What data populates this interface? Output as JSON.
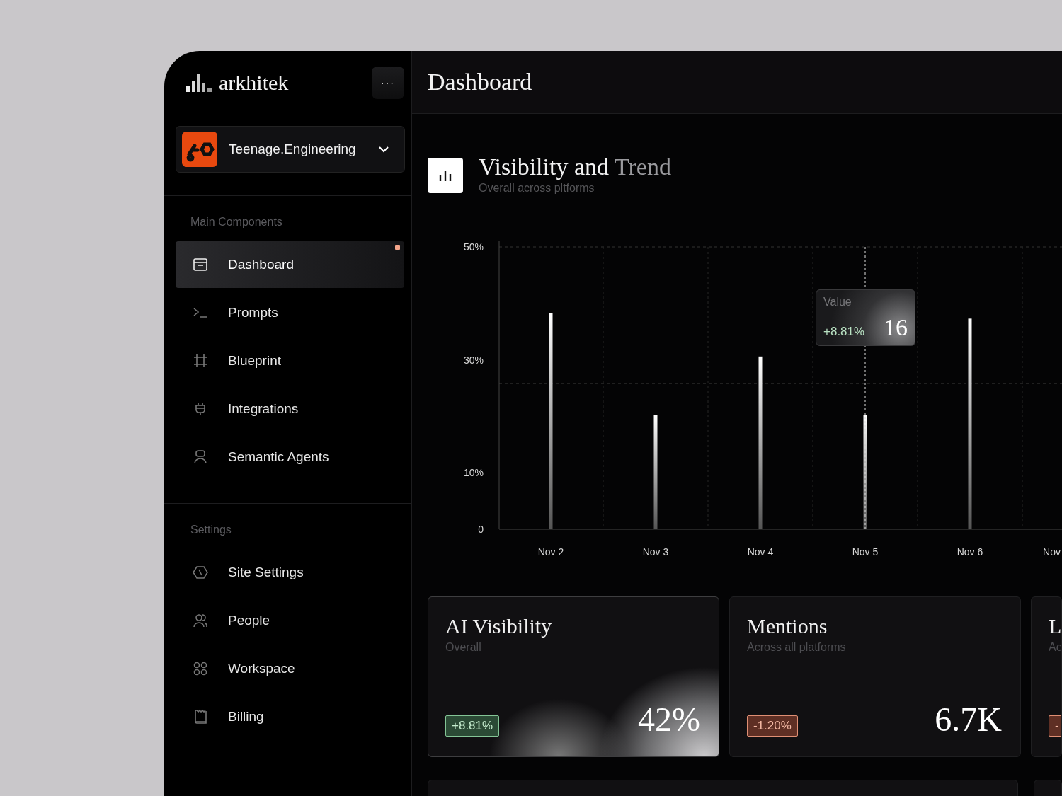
{
  "sidebar": {
    "brand": "arkhitek",
    "more_button": "···",
    "workspace": {
      "name": "Teenage.Engineering"
    },
    "sections": [
      {
        "title": "Main Components",
        "items": [
          {
            "label": "Dashboard",
            "selected": true,
            "notification": true
          },
          {
            "label": "Prompts",
            "selected": false,
            "notification": false
          },
          {
            "label": "Blueprint",
            "selected": false,
            "notification": false
          },
          {
            "label": "Integrations",
            "selected": false,
            "notification": false
          },
          {
            "label": "Semantic Agents",
            "selected": false,
            "notification": false
          }
        ]
      },
      {
        "title": "Settings",
        "items": [
          {
            "label": "Site Settings",
            "selected": false,
            "notification": false
          },
          {
            "label": "People",
            "selected": false,
            "notification": false
          },
          {
            "label": "Workspace",
            "selected": false,
            "notification": false
          },
          {
            "label": "Billing",
            "selected": false,
            "notification": false
          }
        ]
      }
    ]
  },
  "header": {
    "title": "Dashboard"
  },
  "visibility": {
    "title_parts": [
      {
        "text": "Visibility and",
        "muted": false
      },
      {
        "text": "Trend",
        "muted": true
      }
    ],
    "subtitle": "Overall across pltforms",
    "chart_data": {
      "type": "bar",
      "categories": [
        "Nov 2",
        "Nov 3",
        "Nov 4",
        "Nov 5",
        "Nov 6",
        "Nov"
      ],
      "values": [
        38.3,
        20.2,
        30.6,
        20.2,
        37.3,
        null
      ],
      "ylim": [
        0,
        50
      ],
      "yticks": [
        {
          "value": 0,
          "label": "0"
        },
        {
          "value": 10,
          "label": "10%"
        },
        {
          "value": 30,
          "label": "30%"
        },
        {
          "value": 50,
          "label": "50%"
        }
      ],
      "ref_lines": [
        {
          "axis": "y",
          "value": 25.8
        },
        {
          "axis": "x",
          "value": "Nov 5"
        }
      ]
    },
    "tooltip": {
      "label": "Value",
      "change": "+8.81%",
      "value": "16"
    }
  },
  "cards": [
    {
      "title": "AI Visibility",
      "subtitle": "Overall",
      "change": "+8.81%",
      "kind": "positive",
      "value": "42%",
      "highlighted": true
    },
    {
      "title": "Mentions",
      "subtitle": "Across all platforms",
      "change": "-1.20%",
      "kind": "negative",
      "value": "6.7K",
      "highlighted": false
    },
    {
      "title": "L",
      "subtitle": "Ac",
      "change": "-",
      "kind": "negative",
      "highlighted": false
    }
  ]
}
